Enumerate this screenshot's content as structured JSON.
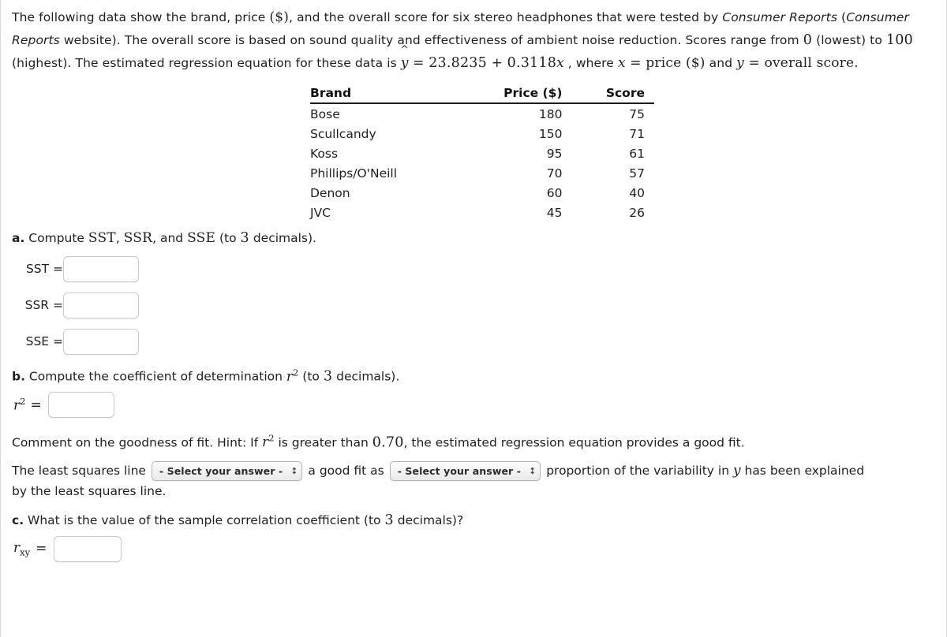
{
  "problem": {
    "intro_part1": "The following data show the brand, price ",
    "intro_dollar": "($)",
    "intro_part2": ", and the overall score for six stereo headphones that were tested by ",
    "source_name": "Consumer Reports",
    "intro_part3": " (",
    "source_name2": "Consumer Reports",
    "intro_part4": " website). The overall score is based on sound quality and effectiveness of ambient noise reduction. Scores range from ",
    "score_min": "0",
    "intro_part5": " (lowest) to ",
    "score_max": "100",
    "intro_part6": " (highest). The estimated regression equation for these data is ",
    "equation_lhs": "y",
    "equation_hat": "^",
    "equation_eq": " = ",
    "equation_intercept": "23.8235",
    "equation_plus": " + ",
    "equation_slope": "0.3118",
    "equation_xvar": "x",
    "intro_part7": " , where ",
    "x_var": "x",
    "x_def": " = price ",
    "x_dollar": "($)",
    "intro_part8": " and ",
    "y_var": "y",
    "y_def": " = overall score",
    "intro_end": "."
  },
  "table": {
    "headers": {
      "brand": "Brand",
      "price": "Price ($)",
      "score": "Score"
    },
    "rows": [
      {
        "brand": "Bose",
        "price": "180",
        "score": "75"
      },
      {
        "brand": "Scullcandy",
        "price": "150",
        "score": "71"
      },
      {
        "brand": "Koss",
        "price": "95",
        "score": "61"
      },
      {
        "brand": "Phillips/O'Neill",
        "price": "70",
        "score": "57"
      },
      {
        "brand": "Denon",
        "price": "60",
        "score": "40"
      },
      {
        "brand": "JVC",
        "price": "45",
        "score": "26"
      }
    ]
  },
  "part_a": {
    "marker": "a.",
    "text_pre": " Compute ",
    "sst": "SST",
    "comma1": ", ",
    "ssr": "SSR",
    "comma2": ", and ",
    "sse": "SSE",
    "text_post": " (to ",
    "decimals": "3",
    "text_end": " decimals).",
    "fields": [
      {
        "label": "SST =",
        "value": "",
        "name": "sst-input"
      },
      {
        "label": "SSR =",
        "value": "",
        "name": "ssr-input"
      },
      {
        "label": "SSE =",
        "value": "",
        "name": "sse-input"
      }
    ]
  },
  "part_b": {
    "marker": "b.",
    "text_pre": " Compute the coefficient of determination ",
    "r_var": "r",
    "r_exp": "2",
    "text_mid": " (to ",
    "decimals": "3",
    "text_end": " decimals).",
    "field_label_var": "r",
    "field_label_exp": "2",
    "field_label_eq": "=",
    "field_value": "",
    "hint_pre": "Comment on the goodness of fit. Hint: If ",
    "hint_r": "r",
    "hint_r_exp": "2",
    "hint_mid": " is greater than ",
    "hint_threshold": "0.70",
    "hint_end": ", the estimated regression equation provides a good fit.",
    "sentence_pre": "The least squares line ",
    "select1_label": "- Select your answer -",
    "select1_arrow": "↕",
    "sentence_mid": " a good fit as ",
    "select2_label": "- Select your answer -",
    "select2_arrow": "↕",
    "sentence_post": " proportion of the variability in ",
    "sentence_yvar": "y",
    "sentence_post2": " has been explained",
    "sentence_line2": "by the least squares line."
  },
  "part_c": {
    "marker": "c.",
    "text_pre": " What is the value of the sample correlation coefficient (to ",
    "decimals": "3",
    "text_end": " decimals)?",
    "field_label_var": "r",
    "field_label_sub": "xy",
    "field_label_eq": "=",
    "field_value": ""
  }
}
